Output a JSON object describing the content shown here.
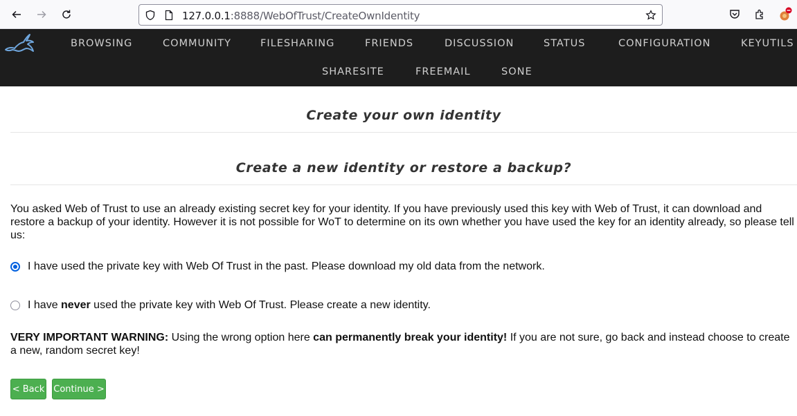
{
  "browser": {
    "url_host": "127.0.0.1",
    "url_path": ":8888/WebOfTrust/CreateOwnIdentity"
  },
  "nav": {
    "row1": [
      "BROWSING",
      "COMMUNITY",
      "FILESHARING",
      "FRIENDS",
      "DISCUSSION",
      "STATUS",
      "CONFIGURATION",
      "KEYUTILS"
    ],
    "row2": [
      "SHARESITE",
      "FREEMAIL",
      "SONE"
    ]
  },
  "page": {
    "title": "Create your own identity",
    "subtitle": "Create a new identity or restore a backup?",
    "intro": "You asked Web of Trust to use an already existing secret key for your identity. If you have previously used this key with Web of Trust, it can download and restore a backup of your identity. However it is not possible for WoT to determine on its own whether you have used the key for an identity already, so please tell us:",
    "option_restore": "I have used the private key with Web Of Trust in the past. Please download my old data from the network.",
    "option_new_prefix": "I have ",
    "option_new_bold": "never",
    "option_new_suffix": " used the private key with Web Of Trust. Please create a new identity.",
    "warning_bold1": "VERY IMPORTANT WARNING:",
    "warning_text1": " Using the wrong option here ",
    "warning_bold2": "can permanently break your identity!",
    "warning_text2": " If you are not sure, go back and instead choose to create a new, random secret key!",
    "back_label": "< Back",
    "continue_label": "Continue >"
  }
}
